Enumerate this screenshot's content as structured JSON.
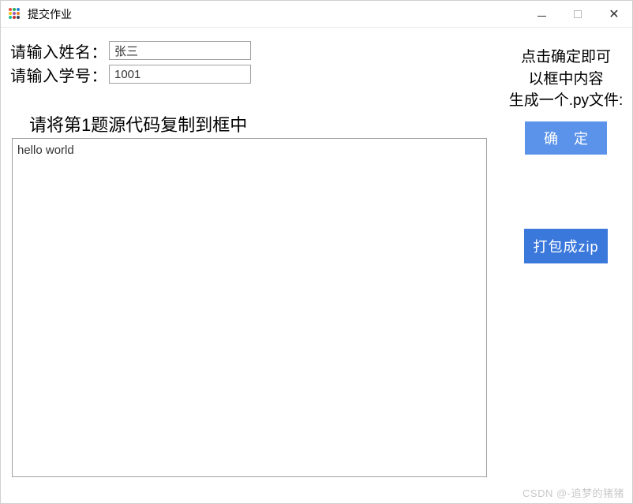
{
  "titlebar": {
    "title": "提交作业"
  },
  "form": {
    "name_label": "请输入姓名：",
    "name_value": "张三",
    "id_label": "请输入学号：",
    "id_value": "1001"
  },
  "main": {
    "instruction": "请将第1题源代码复制到框中",
    "code_value": "hello world"
  },
  "side": {
    "hint_line1": "点击确定即可",
    "hint_line2": "以框中内容",
    "hint_line3": "生成一个.py文件:",
    "confirm_label": "确定",
    "zip_label": "打包成zip"
  },
  "watermark": "CSDN @-追梦的猪猪"
}
